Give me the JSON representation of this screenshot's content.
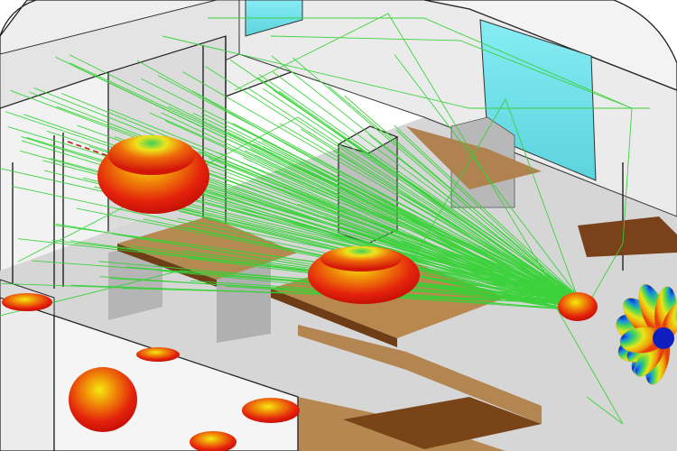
{
  "scene": {
    "description_free": true,
    "colors": {
      "background": "#ffffff",
      "wall_light": "#e9e9e9",
      "wall_mid": "#cfcfcf",
      "floor": "#d8d8d8",
      "desk_wood": "#b3874f",
      "desk_dark": "#6f3e16",
      "glass": "#7fe3ec",
      "ray": "#3cd43c",
      "pattern_red": "#e81c0c",
      "pattern_yellow": "#f2e000",
      "pattern_green": "#39d35a",
      "pattern_blue": "#0f1fbf",
      "dashed_line": "#d01010",
      "outline": "#111111"
    },
    "icons": [
      "antenna-pattern-icon"
    ]
  }
}
